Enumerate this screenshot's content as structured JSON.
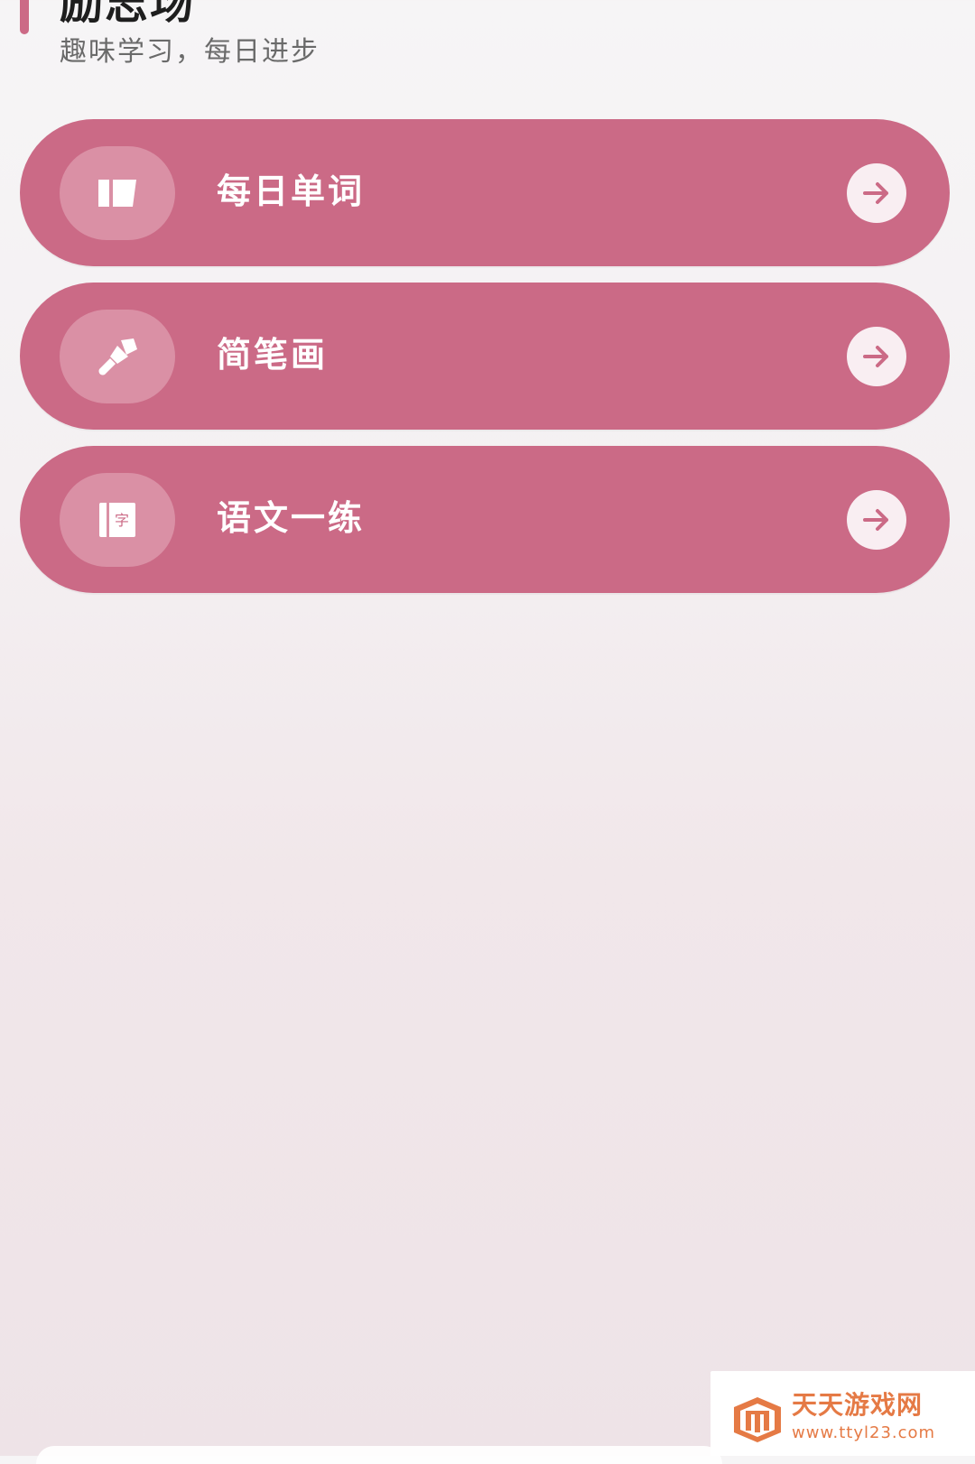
{
  "header": {
    "title": "励志场",
    "subtitle": "趣味学习，每日进步"
  },
  "menu": {
    "items": [
      {
        "label": "每日单词",
        "icon": "book-icon"
      },
      {
        "label": "简笔画",
        "icon": "brush-icon"
      },
      {
        "label": "语文一练",
        "icon": "character-book-icon",
        "icon_glyph": "字"
      }
    ]
  },
  "watermark": {
    "title": "天天游戏网",
    "url": "www.ttyl23.com"
  },
  "colors": {
    "card": "#cb6a86",
    "icon_circle": "#da90a5",
    "accent": "#cc6a86",
    "watermark": "#e57a45"
  }
}
